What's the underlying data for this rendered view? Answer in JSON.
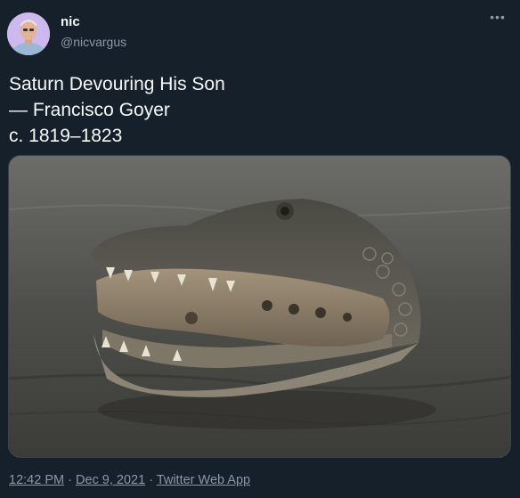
{
  "user": {
    "display_name": "nic",
    "handle": "@nicvargus",
    "avatar_icon": "avatar-photo"
  },
  "more_icon": "more-icon",
  "tweet": {
    "lines": [
      "Saturn Devouring His Son",
      "— Francisco Goyer",
      "c. 1819–1823"
    ]
  },
  "media": {
    "description_icon": "alligator-chewing-crocs-shoe-photo"
  },
  "meta": {
    "time": "12:42 PM",
    "separator": " · ",
    "date": "Dec 9, 2021",
    "source": "Twitter Web App"
  },
  "colors": {
    "background": "#15202b",
    "text": "#f7f9f9",
    "secondary": "#8b98a5",
    "border": "#38444d"
  }
}
